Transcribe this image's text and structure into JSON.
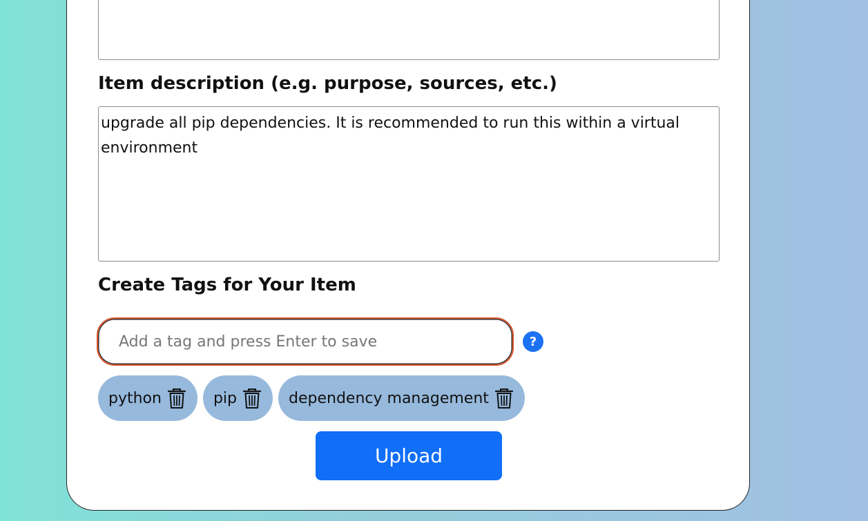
{
  "form": {
    "top_textarea_value": "",
    "description_label": "Item description (e.g. purpose, sources, etc.)",
    "description_value": "upgrade all pip dependencies. It is recommended to run this within a virtual environment",
    "tags_label": "Create Tags for Your Item",
    "tag_input_placeholder": "Add a tag and press Enter to save",
    "tag_input_value": "",
    "help_label": "?",
    "tags": [
      {
        "label": "python",
        "icon": "trash-icon"
      },
      {
        "label": "pip",
        "icon": "trash-icon"
      },
      {
        "label": "dependency management",
        "icon": "trash-icon"
      }
    ],
    "upload_label": "Upload"
  },
  "colors": {
    "accent": "#106ef7",
    "tag_background": "#96b9dc",
    "focus_border": "#d9542b"
  }
}
